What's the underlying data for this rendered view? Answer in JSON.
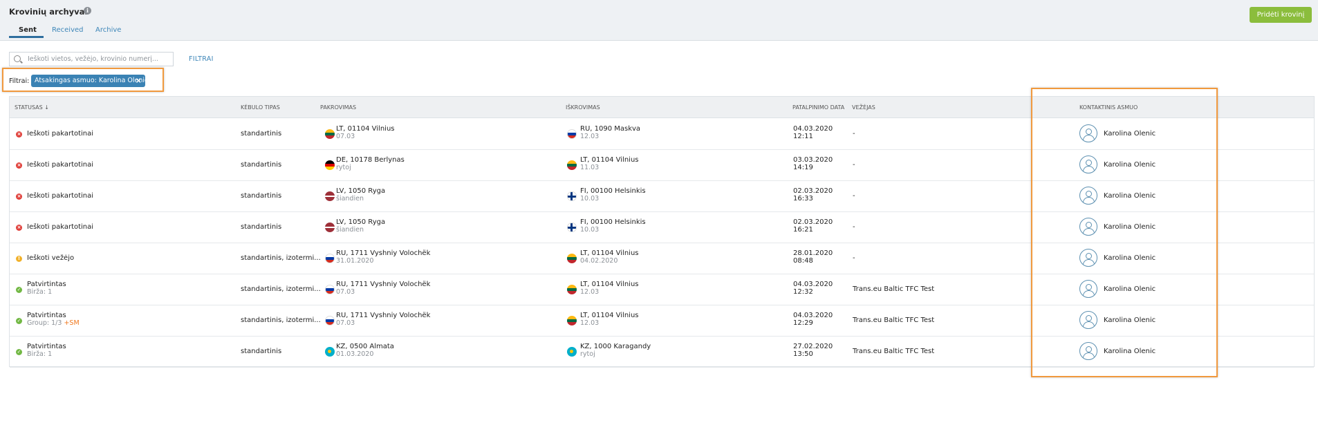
{
  "header": {
    "title": "Krovinių archyvas",
    "info_icon": "info-icon",
    "tabs": [
      {
        "label": "Sent",
        "active": true
      },
      {
        "label": "Received",
        "active": false
      },
      {
        "label": "Archive",
        "active": false
      }
    ],
    "add_button_label": "Pridėti krovinį"
  },
  "search": {
    "placeholder": "Ieškoti vietos, vežėjo, krovinio numerį...",
    "icon": "search-icon"
  },
  "filters_link": "FILTRAI",
  "active_filters": {
    "label": "Filtrai:",
    "chips": [
      {
        "text": "Atsakingas asmuo: Karolina Olenic",
        "remove": "×"
      }
    ]
  },
  "table": {
    "columns": [
      "STATUSAS ↓",
      "KĖBULO TIPAS",
      "PAKROVIMAS",
      "IŠKROVIMAS",
      "PATALPINIMO DATA",
      "VEŽĖJAS",
      "KONTAKTINIS ASMUO"
    ],
    "rows": [
      {
        "status": "Ieškoti pakartotinai",
        "status_sub": "",
        "status_sub_extra": "",
        "status_color": "red",
        "body": "standartinis",
        "load_flag": "lt",
        "load_place": "LT, 01104 Vilnius",
        "load_date": "07.03",
        "unload_flag": "ru",
        "unload_place": "RU, 1090 Maskva",
        "unload_date": "12.03",
        "posted_date": "04.03.2020",
        "posted_time": "12:11",
        "carrier": "-",
        "contact": "Karolina Olenic"
      },
      {
        "status": "Ieškoti pakartotinai",
        "status_sub": "",
        "status_sub_extra": "",
        "status_color": "red",
        "body": "standartinis",
        "load_flag": "de",
        "load_place": "DE, 10178 Berlynas",
        "load_date": "rytoj",
        "unload_flag": "lt",
        "unload_place": "LT, 01104 Vilnius",
        "unload_date": "11.03",
        "posted_date": "03.03.2020",
        "posted_time": "14:19",
        "carrier": "-",
        "contact": "Karolina Olenic"
      },
      {
        "status": "Ieškoti pakartotinai",
        "status_sub": "",
        "status_sub_extra": "",
        "status_color": "red",
        "body": "standartinis",
        "load_flag": "lv",
        "load_place": "LV, 1050 Ryga",
        "load_date": "šiandien",
        "unload_flag": "fi",
        "unload_place": "FI, 00100 Helsinkis",
        "unload_date": "10.03",
        "posted_date": "02.03.2020",
        "posted_time": "16:33",
        "carrier": "-",
        "contact": "Karolina Olenic"
      },
      {
        "status": "Ieškoti pakartotinai",
        "status_sub": "",
        "status_sub_extra": "",
        "status_color": "red",
        "body": "standartinis",
        "load_flag": "lv",
        "load_place": "LV, 1050 Ryga",
        "load_date": "šiandien",
        "unload_flag": "fi",
        "unload_place": "FI, 00100 Helsinkis",
        "unload_date": "10.03",
        "posted_date": "02.03.2020",
        "posted_time": "16:21",
        "carrier": "-",
        "contact": "Karolina Olenic"
      },
      {
        "status": "Ieškoti vežėjo",
        "status_sub": "",
        "status_sub_extra": "",
        "status_color": "yellow",
        "body": "standartinis, izotermi...",
        "load_flag": "ru",
        "load_place": "RU, 1711 Vyshniy Volochëk",
        "load_date": "31.01.2020",
        "unload_flag": "lt",
        "unload_place": "LT, 01104 Vilnius",
        "unload_date": "04.02.2020",
        "posted_date": "28.01.2020",
        "posted_time": "08:48",
        "carrier": "-",
        "contact": "Karolina Olenic"
      },
      {
        "status": "Patvirtintas",
        "status_sub": "Birža: 1",
        "status_sub_extra": "",
        "status_color": "green",
        "body": "standartinis, izotermi...",
        "load_flag": "ru",
        "load_place": "RU, 1711 Vyshniy Volochëk",
        "load_date": "07.03",
        "unload_flag": "lt",
        "unload_place": "LT, 01104 Vilnius",
        "unload_date": "12.03",
        "posted_date": "04.03.2020",
        "posted_time": "12:32",
        "carrier": "Trans.eu Baltic TFC Test",
        "contact": "Karolina Olenic"
      },
      {
        "status": "Patvirtintas",
        "status_sub": "Group: 1/3 ",
        "status_sub_extra": "+SM",
        "status_color": "green",
        "body": "standartinis, izotermi...",
        "load_flag": "ru",
        "load_place": "RU, 1711 Vyshniy Volochëk",
        "load_date": "07.03",
        "unload_flag": "lt",
        "unload_place": "LT, 01104 Vilnius",
        "unload_date": "12.03",
        "posted_date": "04.03.2020",
        "posted_time": "12:29",
        "carrier": "Trans.eu Baltic TFC Test",
        "contact": "Karolina Olenic"
      },
      {
        "status": "Patvirtintas",
        "status_sub": "Birža: 1",
        "status_sub_extra": "",
        "status_color": "green",
        "body": "standartinis",
        "load_flag": "kz",
        "load_place": "KZ, 0500 Almata",
        "load_date": "01.03.2020",
        "unload_flag": "kz",
        "unload_place": "KZ, 1000 Karagandy",
        "unload_date": "rytoj",
        "posted_date": "27.02.2020",
        "posted_time": "13:50",
        "carrier": "Trans.eu Baltic TFC Test",
        "contact": "Karolina Olenic"
      }
    ]
  }
}
